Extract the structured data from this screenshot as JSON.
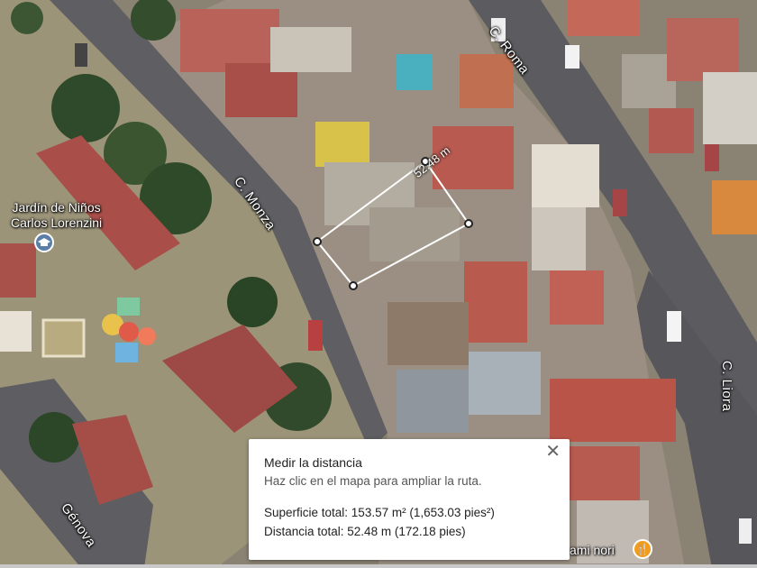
{
  "map": {
    "streets": {
      "roma": "C. Roma",
      "monza": "C. Monza",
      "liora": "C. Liora",
      "genova": "Génova"
    },
    "poi": {
      "school_line1": "Jardín de Niños",
      "school_line2": "Carlos Lorenzini",
      "school_icon": "school-icon",
      "restaurant_fragment": "ami nori",
      "restaurant_icon": "restaurant-icon"
    },
    "measurement": {
      "segment_label": "52.48 m",
      "line_color": "#ffffff",
      "vertex_count": 4
    }
  },
  "panel": {
    "title": "Medir la distancia",
    "hint": "Haz clic en el mapa para ampliar la ruta.",
    "area": "Superficie total: 153.57 m² (1,653.03 pies²)",
    "distance": "Distancia total: 52.48 m (172.18 pies)",
    "close_icon": "close-icon",
    "close_glyph": "✕"
  }
}
